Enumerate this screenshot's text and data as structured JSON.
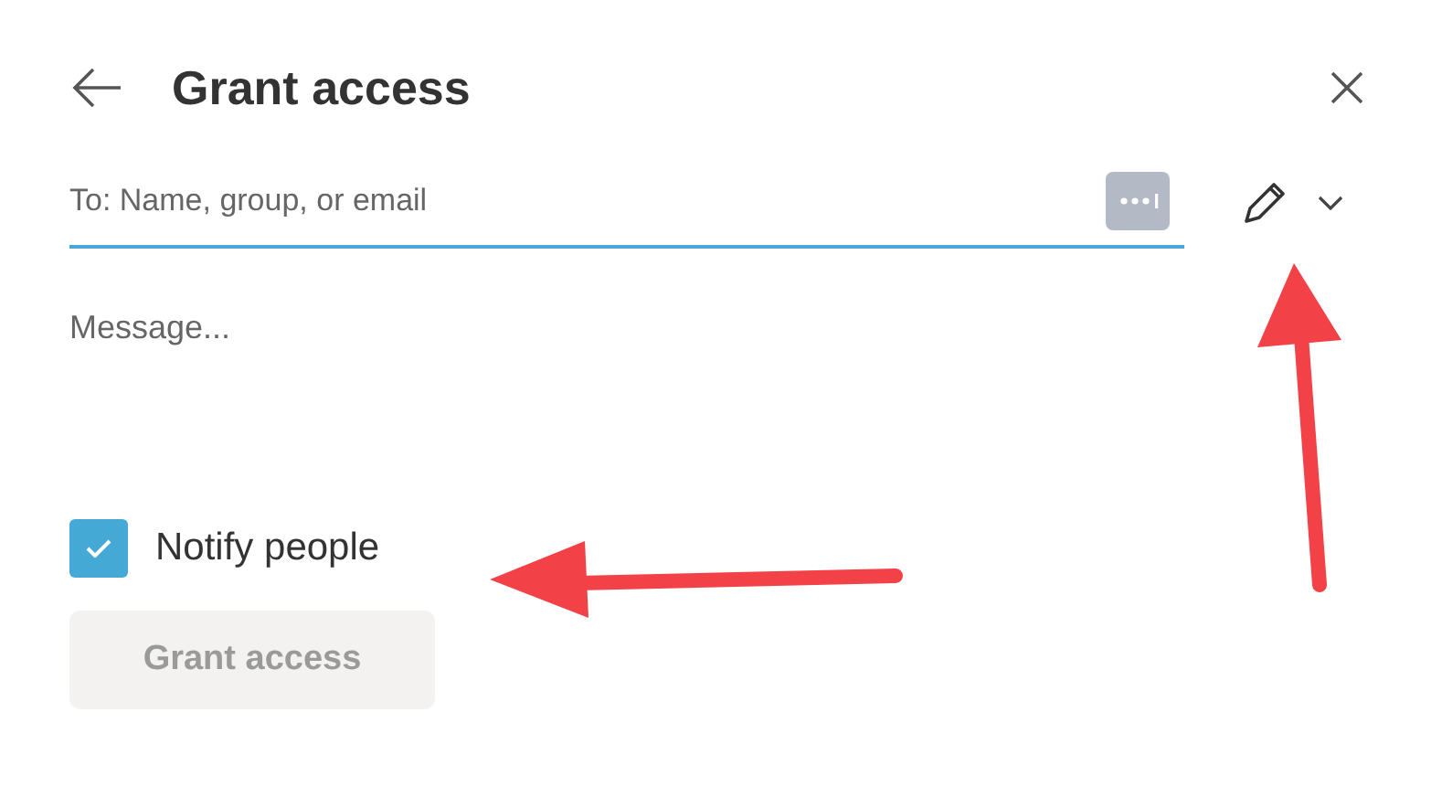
{
  "dialog": {
    "title": "Grant access"
  },
  "recipient_field": {
    "placeholder": "To: Name, group, or email"
  },
  "message_field": {
    "placeholder": "Message..."
  },
  "notify": {
    "label": "Notify people",
    "checked": true
  },
  "submit_button": {
    "label": "Grant access",
    "disabled": true
  }
}
